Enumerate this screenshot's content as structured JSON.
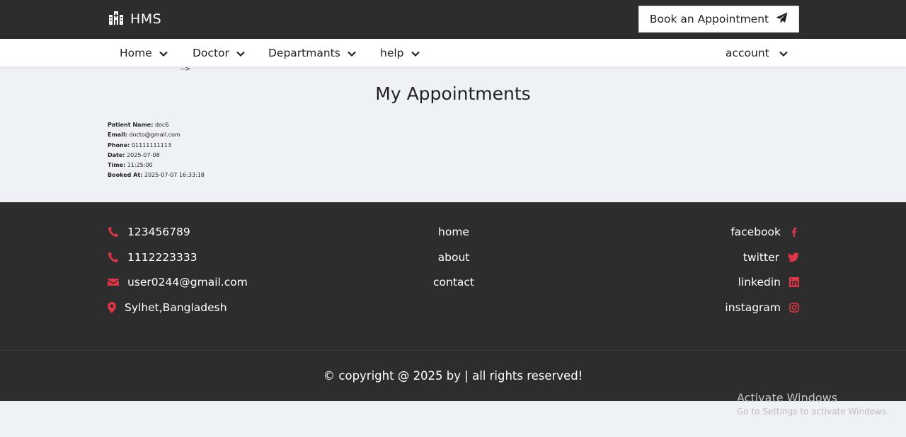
{
  "header": {
    "logo_text": "HMS",
    "logo_icon": "hospital-icon",
    "book_button": "Book an Appointment",
    "book_icon": "paper-plane-icon"
  },
  "nav": {
    "items": [
      {
        "label": "Home"
      },
      {
        "label": "Doctor"
      },
      {
        "label": "Departmants"
      },
      {
        "label": "help"
      }
    ],
    "account": "account"
  },
  "stray_text": "-->",
  "page": {
    "title": "My Appointments"
  },
  "appointment": {
    "patient_name_label": "Patient Name:",
    "patient_name": "doc6",
    "email_label": "Email:",
    "email": "docto@gmail.com",
    "phone_label": "Phone:",
    "phone": "01111111113",
    "date_label": "Date:",
    "date": "2025-07-08",
    "time_label": "Time:",
    "time": "11:25:00",
    "booked_label": "Booked At:",
    "booked": "2025-07-07 16:33:18"
  },
  "footer": {
    "contacts": [
      {
        "icon": "phone-icon",
        "text": "123456789"
      },
      {
        "icon": "phone-icon",
        "text": "1112223333"
      },
      {
        "icon": "envelope-icon",
        "text": "user0244@gmail.com"
      },
      {
        "icon": "map-marker-icon",
        "text": "Sylhet,Bangladesh"
      }
    ],
    "links": [
      "home",
      "about",
      "contact"
    ],
    "social": [
      {
        "icon": "facebook-icon",
        "text": "facebook"
      },
      {
        "icon": "twitter-icon",
        "text": "twitter"
      },
      {
        "icon": "linkedin-icon",
        "text": "linkedin"
      },
      {
        "icon": "instagram-icon",
        "text": "instagram"
      }
    ],
    "copyright": "© copyright @ 2025 by | all rights reserved!"
  },
  "watermark": {
    "title": "Activate Windows",
    "subtitle": "Go to Settings to activate Windows."
  },
  "colors": {
    "dark": "#2d2d2d",
    "accent": "#e03545",
    "page_bg": "#eef2f7"
  }
}
